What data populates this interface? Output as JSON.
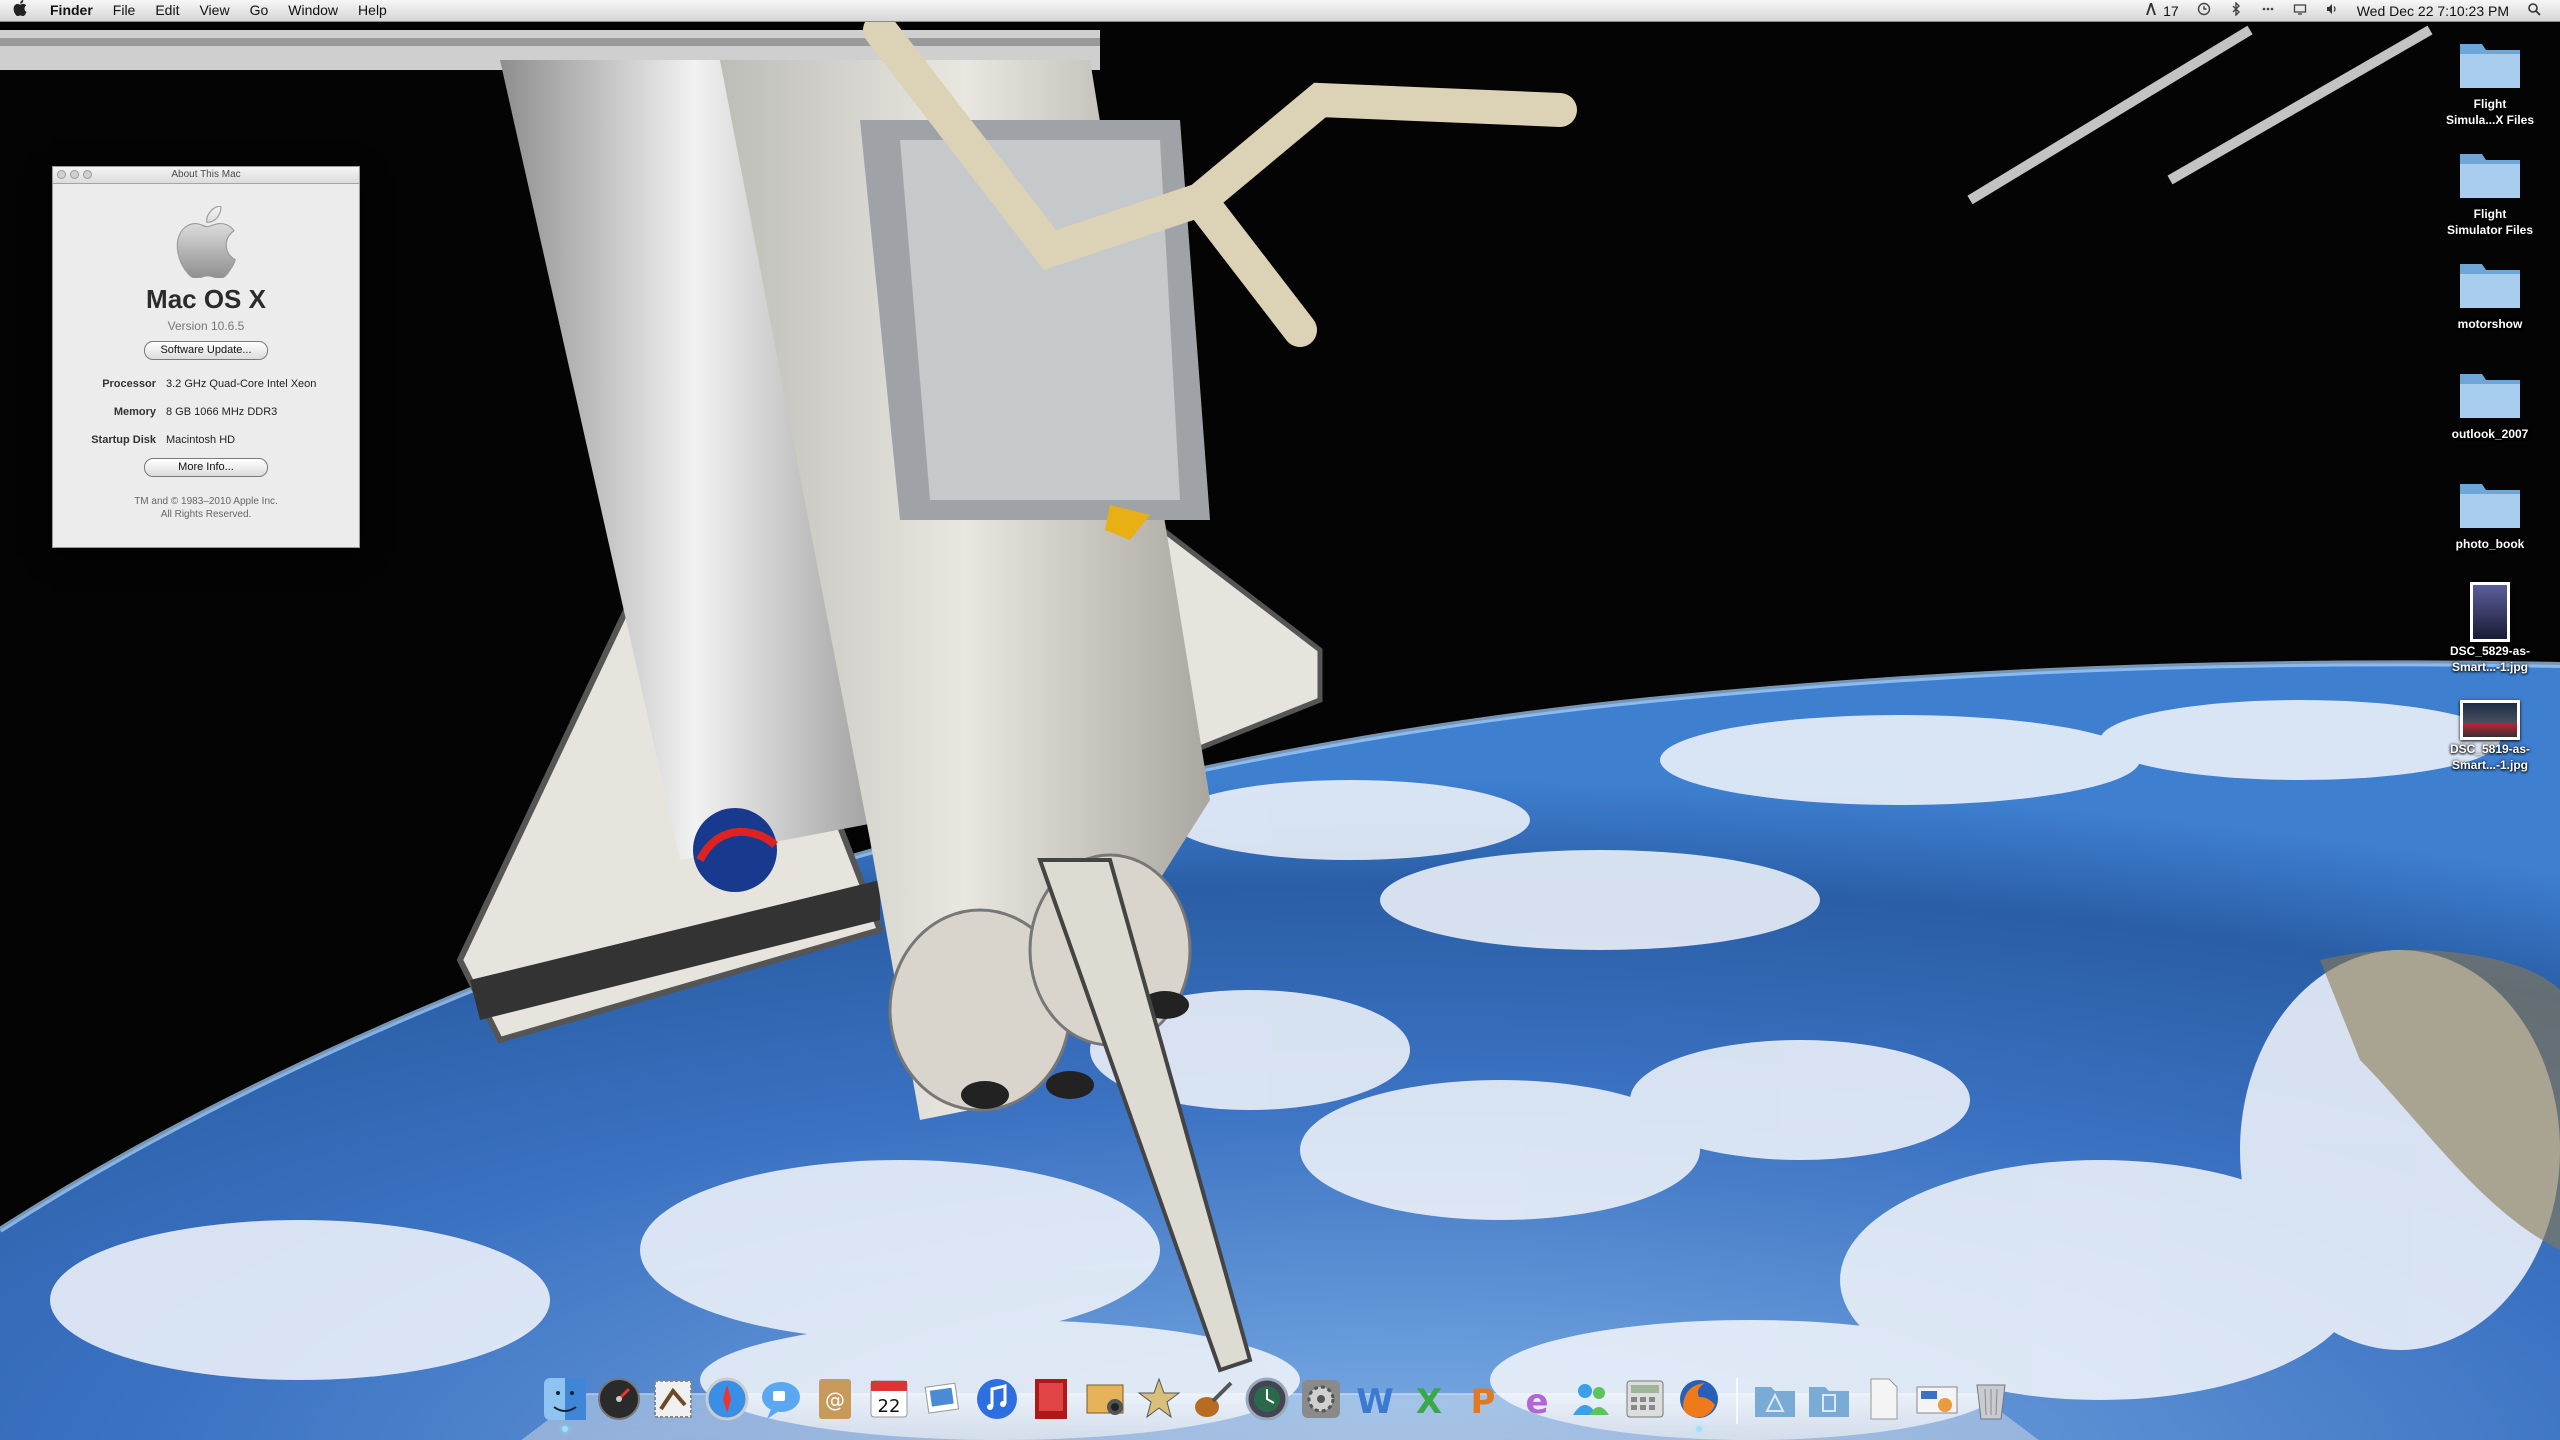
{
  "menubar": {
    "app_name": "Finder",
    "menus": [
      "File",
      "Edit",
      "View",
      "Go",
      "Window",
      "Help"
    ],
    "status": {
      "adobe_badge": "17",
      "clock": "Wed Dec 22  7:10:23 PM"
    }
  },
  "about_window": {
    "title": "About This Mac",
    "os_name": "Mac OS X",
    "version": "Version 10.6.5",
    "software_update_label": "Software Update...",
    "specs": [
      {
        "key": "Processor",
        "value": "3.2 GHz Quad-Core Intel Xeon"
      },
      {
        "key": "Memory",
        "value": "8 GB 1066 MHz DDR3"
      },
      {
        "key": "Startup Disk",
        "value": "Macintosh HD"
      }
    ],
    "more_info_label": "More Info...",
    "copyright_line1": "TM and © 1983–2010 Apple Inc.",
    "copyright_line2": "All Rights Reserved."
  },
  "desktop_icons": [
    {
      "label1": "Flight",
      "label2": "Simula...X Files",
      "kind": "folder"
    },
    {
      "label1": "Flight",
      "label2": "Simulator Files",
      "kind": "folder"
    },
    {
      "label1": "motorshow",
      "label2": "",
      "kind": "folder"
    },
    {
      "label1": "outlook_2007",
      "label2": "",
      "kind": "folder"
    },
    {
      "label1": "photo_book",
      "label2": "",
      "kind": "folder"
    },
    {
      "label1": "DSC_5829-as-",
      "label2": "Smart...-1.jpg",
      "kind": "portrait-image"
    },
    {
      "label1": "DSC_5819-as-",
      "label2": "Smart...-1.jpg",
      "kind": "landscape-image"
    }
  ],
  "dock": {
    "calendar_day": "22",
    "apps": [
      "finder-icon",
      "dashboard-icon",
      "mail-stamp-icon",
      "safari-icon",
      "ichat-icon",
      "address-book-icon",
      "ical-icon",
      "iphoto-icon",
      "itunes-icon",
      "photo-booth-icon",
      "image-capture-icon",
      "imovie-icon",
      "garageband-icon",
      "time-machine-icon",
      "system-preferences-icon",
      "word-icon",
      "excel-icon",
      "powerpoint-icon",
      "entourage-icon",
      "messenger-icon",
      "calculator-icon",
      "firefox-icon"
    ],
    "stacks": [
      "applications-stack-icon",
      "documents-stack-icon",
      "file-icon",
      "preview-icon",
      "trash-icon"
    ]
  },
  "colors": {
    "menubar": "#e9e9e9",
    "earth_blue": "#2f67b0",
    "space": "#050507"
  }
}
